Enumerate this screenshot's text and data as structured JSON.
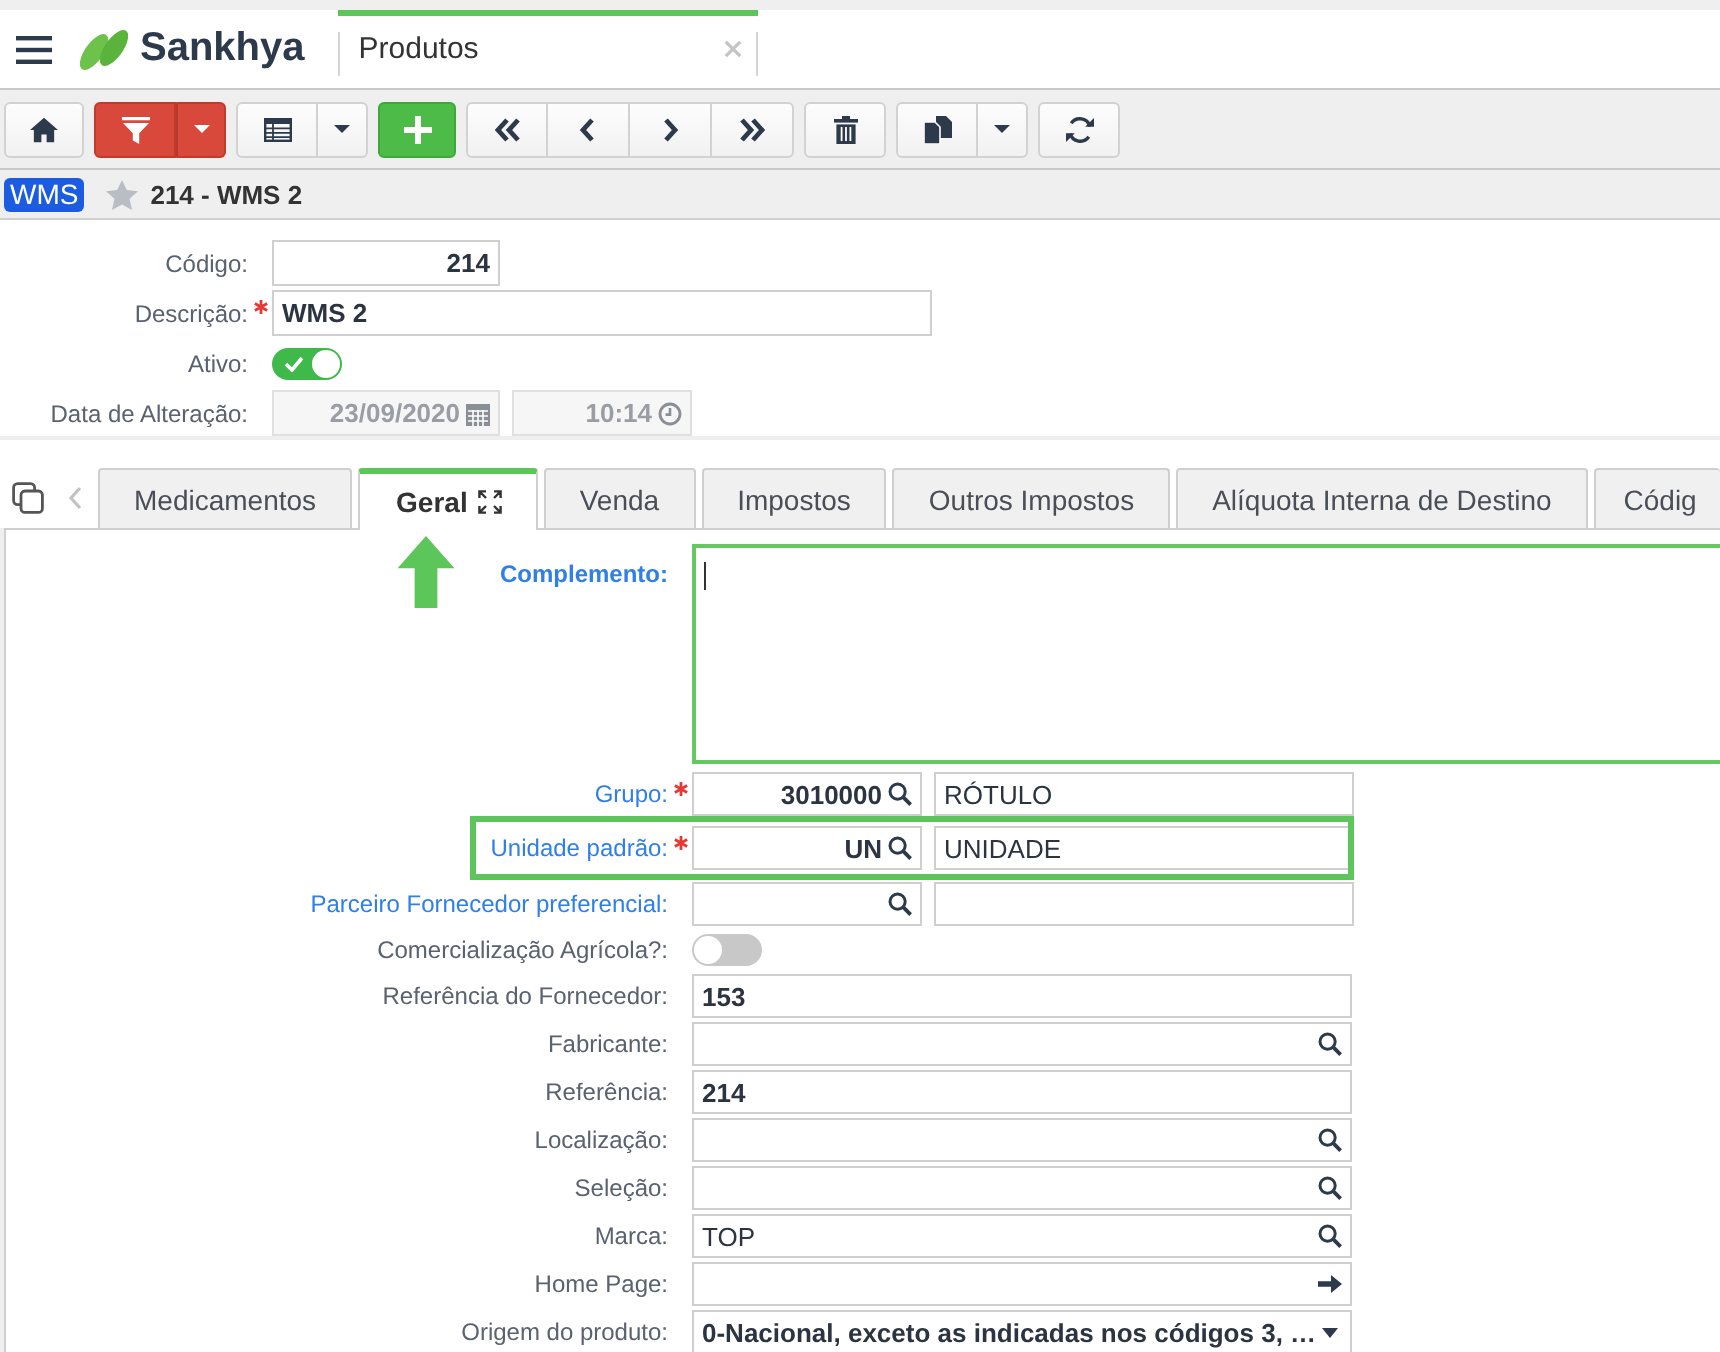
{
  "header": {
    "app_name": "Sankhya",
    "tab": {
      "title": "Produtos"
    }
  },
  "record": {
    "badge": "WMS",
    "title": "214 - WMS 2",
    "starred": false
  },
  "form": {
    "fields": [
      {
        "kind": "number",
        "label": "Código:",
        "required": false,
        "disabled": false,
        "value": "214"
      },
      {
        "kind": "text",
        "label": "Descrição:",
        "required": true,
        "disabled": false,
        "value": "WMS 2"
      },
      {
        "kind": "toggle",
        "label": "Ativo:",
        "required": false,
        "disabled": false,
        "on": true
      },
      {
        "kind": "datetime",
        "label": "Data de Alteração:",
        "required": false,
        "disabled": true,
        "date": "23/09/2020",
        "time": "10:14"
      }
    ]
  },
  "tabs": [
    {
      "label": "Medicamentos",
      "selected": false,
      "arrow": false
    },
    {
      "label": "Geral",
      "selected": true,
      "arrow": true
    },
    {
      "label": "Venda",
      "selected": false,
      "arrow": false
    },
    {
      "label": "Impostos",
      "selected": false,
      "arrow": false
    },
    {
      "label": "Outros Impostos",
      "selected": false,
      "arrow": false
    },
    {
      "label": "Alíquota Interna de Destino",
      "selected": false,
      "arrow": false
    },
    {
      "label": "Códig",
      "selected": false,
      "arrow": false
    }
  ],
  "panel": {
    "fields": [
      {
        "kind": "textarea",
        "label": "Complemento:",
        "link": true,
        "required": false,
        "focused": true,
        "highlighted": false
      },
      {
        "kind": "lookup",
        "label": "Grupo:",
        "link": true,
        "required": true,
        "focused": false,
        "highlighted": false,
        "code": "3010000",
        "value": "RÓTULO"
      },
      {
        "kind": "lookup",
        "label": "Unidade padrão:",
        "link": true,
        "required": true,
        "focused": false,
        "highlighted": true,
        "code": "UN",
        "value": "UNIDADE"
      },
      {
        "kind": "lookup",
        "label": "Parceiro Fornecedor preferencial:",
        "link": true,
        "required": false,
        "focused": false,
        "highlighted": false
      },
      {
        "kind": "toggle",
        "label": "Comercialização Agrícola?:",
        "link": false,
        "required": false,
        "focused": false,
        "highlighted": false,
        "on": false
      },
      {
        "kind": "text",
        "label": "Referência do Fornecedor:",
        "link": false,
        "required": false,
        "focused": false,
        "highlighted": false,
        "value": "153"
      },
      {
        "kind": "search",
        "label": "Fabricante:",
        "link": false,
        "required": false,
        "focused": false,
        "highlighted": false
      },
      {
        "kind": "text",
        "label": "Referência:",
        "link": false,
        "required": false,
        "focused": false,
        "highlighted": false,
        "value": "214"
      },
      {
        "kind": "search",
        "label": "Localização:",
        "link": false,
        "required": false,
        "focused": false,
        "highlighted": false
      },
      {
        "kind": "search",
        "label": "Seleção:",
        "link": false,
        "required": false,
        "focused": false,
        "highlighted": false
      },
      {
        "kind": "search",
        "label": "Marca:",
        "link": false,
        "required": false,
        "focused": false,
        "highlighted": false,
        "value": "TOP"
      },
      {
        "kind": "url",
        "label": "Home Page:",
        "link": false,
        "required": false,
        "focused": false,
        "highlighted": false
      },
      {
        "kind": "select",
        "label": "Origem do produto:",
        "link": false,
        "required": false,
        "focused": false,
        "highlighted": false,
        "value": "0-Nacional, exceto as indicadas nos códigos 3, …"
      }
    ]
  }
}
